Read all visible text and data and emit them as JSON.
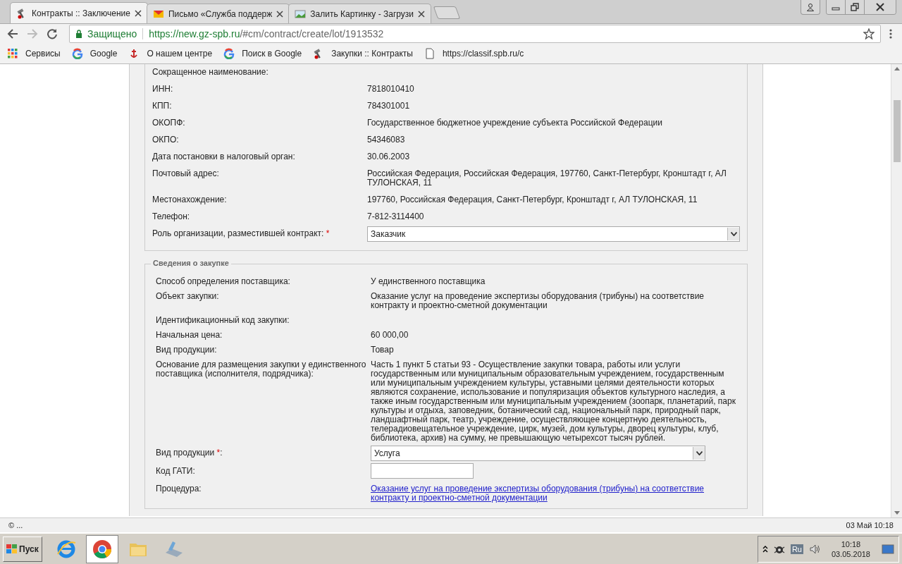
{
  "browser": {
    "tabs": [
      {
        "title": "Контракты :: Заключение",
        "selected": true
      },
      {
        "title": "Письмо «Служба поддерж",
        "selected": false
      },
      {
        "title": "Залить Картинку - Загрузи",
        "selected": false
      }
    ],
    "address": {
      "secure_label": "Защищено",
      "url_host": "https://new.gz-spb.ru",
      "url_path": "/#cm/contract/create/lot/1913532"
    },
    "bookmarks": [
      {
        "label": "Сервисы"
      },
      {
        "label": "Google"
      },
      {
        "label": "О нашем центре"
      },
      {
        "label": "Поиск в Google"
      },
      {
        "label": "Закупки :: Контракты"
      },
      {
        "label": "https://classif.spb.ru/c"
      }
    ]
  },
  "organization": {
    "rows": [
      {
        "label": "Сокращенное наименование:",
        "kind": "text"
      },
      {
        "label": "ИНН:",
        "value": "7818010410",
        "kind": "text"
      },
      {
        "label": "КПП:",
        "value": "784301001",
        "kind": "text"
      },
      {
        "label": "ОКОПФ:",
        "value": "Государственное бюджетное учреждение субъекта Российской Федерации",
        "kind": "text"
      },
      {
        "label": "ОКПО:",
        "value": "54346083",
        "kind": "text"
      },
      {
        "label": "Дата постановки в налоговый орган:",
        "value": "30.06.2003",
        "kind": "text"
      },
      {
        "label": "Почтовый адрес:",
        "value": "Российская Федерация, Российская Федерация, 197760, Санкт-Петербург, Кронштадт г, АЛ ТУЛОНСКАЯ, 11",
        "kind": "text"
      },
      {
        "label": "Местонахождение:",
        "value": "197760, Российская Федерация, Санкт-Петербург, Кронштадт г, АЛ ТУЛОНСКАЯ, 11",
        "kind": "text"
      },
      {
        "label": "Телефон:",
        "value": "7-812-3114400",
        "kind": "text"
      },
      {
        "label": "Роль организации, разместившей контракт:",
        "mark": "*",
        "value": "Заказчик",
        "kind": "select"
      }
    ]
  },
  "purchase": {
    "legend": "Сведения о закупке",
    "rows": [
      {
        "label": "Способ определения поставщика:",
        "value": "У единственного поставщика",
        "kind": "text"
      },
      {
        "label": "Объект закупки:",
        "value": "Оказание услуг на проведение экспертизы оборудования (трибуны) на соответствие контракту и проектно-сметной документации",
        "kind": "text"
      },
      {
        "label": "Идентификационный код закупки:",
        "kind": "text"
      },
      {
        "label": "Начальная цена:",
        "value": "60 000,00",
        "kind": "text"
      },
      {
        "label": "Вид продукции:",
        "value": "Товар",
        "kind": "text"
      },
      {
        "label": "Основание для размещения закупки у единственного поставщика (исполнителя, подрядчика):",
        "value": "Часть 1 пункт 5 статьи 93 - Осуществление закупки товара, работы или услуги государственным или муниципальным образовательным учреждением, государственным или муниципальным учреждением культуры, уставными целями деятельности которых являются сохранение, использование и популяризация объектов культурного наследия, а также иным государственным или муниципальным учреждением (зоопарк, планетарий, парк культуры и отдыха, заповедник, ботанический сад, национальный парк, природный парк, ландшафтный парк, театр, учреждение, осуществляющее концертную деятельность, телерадиовещательное учреждение, цирк, музей, дом культуры, дворец культуры, клуб, библиотека, архив) на сумму, не превышающую четырехсот тысяч рублей.",
        "kind": "text"
      },
      {
        "label": "Вид продукции",
        "mark": "*",
        "after_mark": ":",
        "value": "Услуга",
        "kind": "select"
      },
      {
        "label": "Код ГАТИ:",
        "kind": "input"
      },
      {
        "label": "Процедура:",
        "value": "Оказание услуг на проведение экспертизы оборудования (трибуны) на соответствие контракту и проектно-сметной документации",
        "kind": "link"
      }
    ]
  },
  "status_bar": {
    "left": "© ...",
    "right": "03 Май 10:18"
  },
  "taskbar": {
    "start_label": "Пуск",
    "apps": [
      {
        "selected": false
      },
      {
        "selected": true
      },
      {
        "selected": false
      },
      {
        "selected": false
      }
    ],
    "language": "Ru",
    "time": "10:18",
    "date": "03.05.2018"
  }
}
